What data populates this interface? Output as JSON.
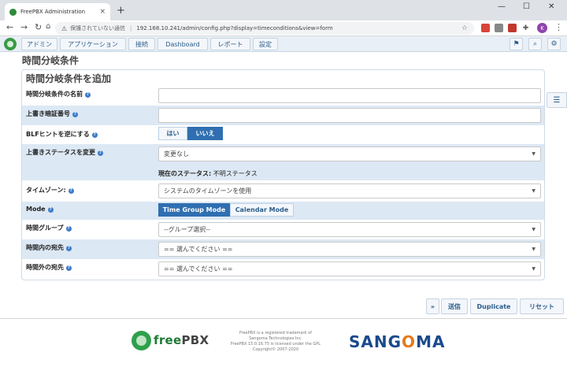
{
  "browser": {
    "tab_title": "FreePBX Administration",
    "tab_close": "×",
    "new_tab": "+",
    "win_min": "—",
    "win_max": "☐",
    "win_close": "✕",
    "not_secure": "保護されていない通信",
    "url": "192.168.10.241/admin/config.php?display=timeconditions&view=form",
    "profile_initial": "K"
  },
  "menu": {
    "items": [
      "アドミン",
      "アプリケーション",
      "接続",
      "Dashboard",
      "レポート",
      "設定"
    ]
  },
  "page": {
    "title": "時間分岐条件",
    "panel_title": "時間分岐条件を追加"
  },
  "form": {
    "name_label": "時間分岐条件の名前",
    "override_code_label": "上書き暗証番号",
    "blf_label": "BLFヒントを逆にする",
    "blf_yes": "はい",
    "blf_no": "いいえ",
    "override_state_label": "上書きステータスを変更",
    "override_state_value": "変更なし",
    "current_status_label": "現在のステータス:",
    "current_status_value": "不明ステータス",
    "timezone_label": "タイムゾーン:",
    "timezone_value": "システムのタイムゾーンを使用",
    "mode_label": "Mode",
    "mode_time_group": "Time Group Mode",
    "mode_calendar": "Calendar Mode",
    "time_group_label": "時間グループ",
    "time_group_value": "--グループ選択--",
    "match_dest_label": "時間内の宛先",
    "match_dest_value": "== 選んでください ==",
    "nomatch_dest_label": "時間外の宛先",
    "nomatch_dest_value": "== 選んでください =="
  },
  "actions": {
    "collapse": "»",
    "submit": "送信",
    "duplicate": "Duplicate",
    "reset": "リセット"
  },
  "footer": {
    "freepbx_logo_a": "free",
    "freepbx_logo_b": "PBX",
    "legal_1": "FreePBX is a registered trademark of",
    "legal_2": "Sangoma Technologies Inc.",
    "legal_3": "FreePBX 15.0.16.75 is licensed under the GPL",
    "legal_4": "Copyright© 2007-2020",
    "sangoma_a": "SANG",
    "sangoma_o": "O",
    "sangoma_b": "MA"
  },
  "colors": {
    "accent": "#2f6fb1",
    "row_alt": "#dce8f4"
  }
}
